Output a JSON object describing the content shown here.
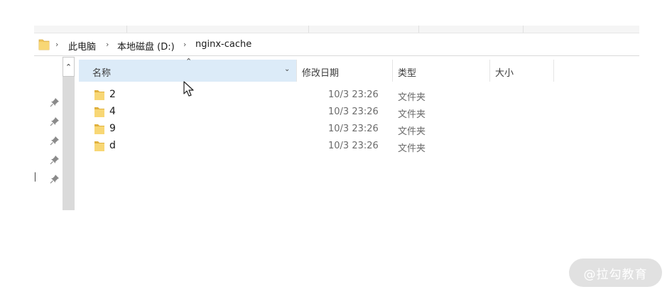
{
  "breadcrumb": {
    "items": [
      "此电脑",
      "本地磁盘 (D:)",
      "nginx-cache"
    ]
  },
  "columns": {
    "name": "名称",
    "modified": "修改日期",
    "type": "类型",
    "size": "大小"
  },
  "files": [
    {
      "name": "2",
      "modified": "10/3 23:26",
      "type": "文件夹"
    },
    {
      "name": "4",
      "modified": "10/3 23:26",
      "type": "文件夹"
    },
    {
      "name": "9",
      "modified": "10/3 23:26",
      "type": "文件夹"
    },
    {
      "name": "d",
      "modified": "10/3 23:26",
      "type": "文件夹"
    }
  ],
  "icons": {
    "folder": "folder-icon",
    "chevron": "chevron-right-icon",
    "pin": "pin-icon",
    "sort": "sort-ascending-icon",
    "dropdown": "chevron-down-icon",
    "scroll_up": "scroll-up-icon",
    "cursor": "mouse-cursor-icon"
  },
  "colors": {
    "selected_header": "#dcebf8",
    "folder_yellow": "#f8d775",
    "folder_dark": "#e0b13e"
  },
  "watermark": "@拉勾教育"
}
